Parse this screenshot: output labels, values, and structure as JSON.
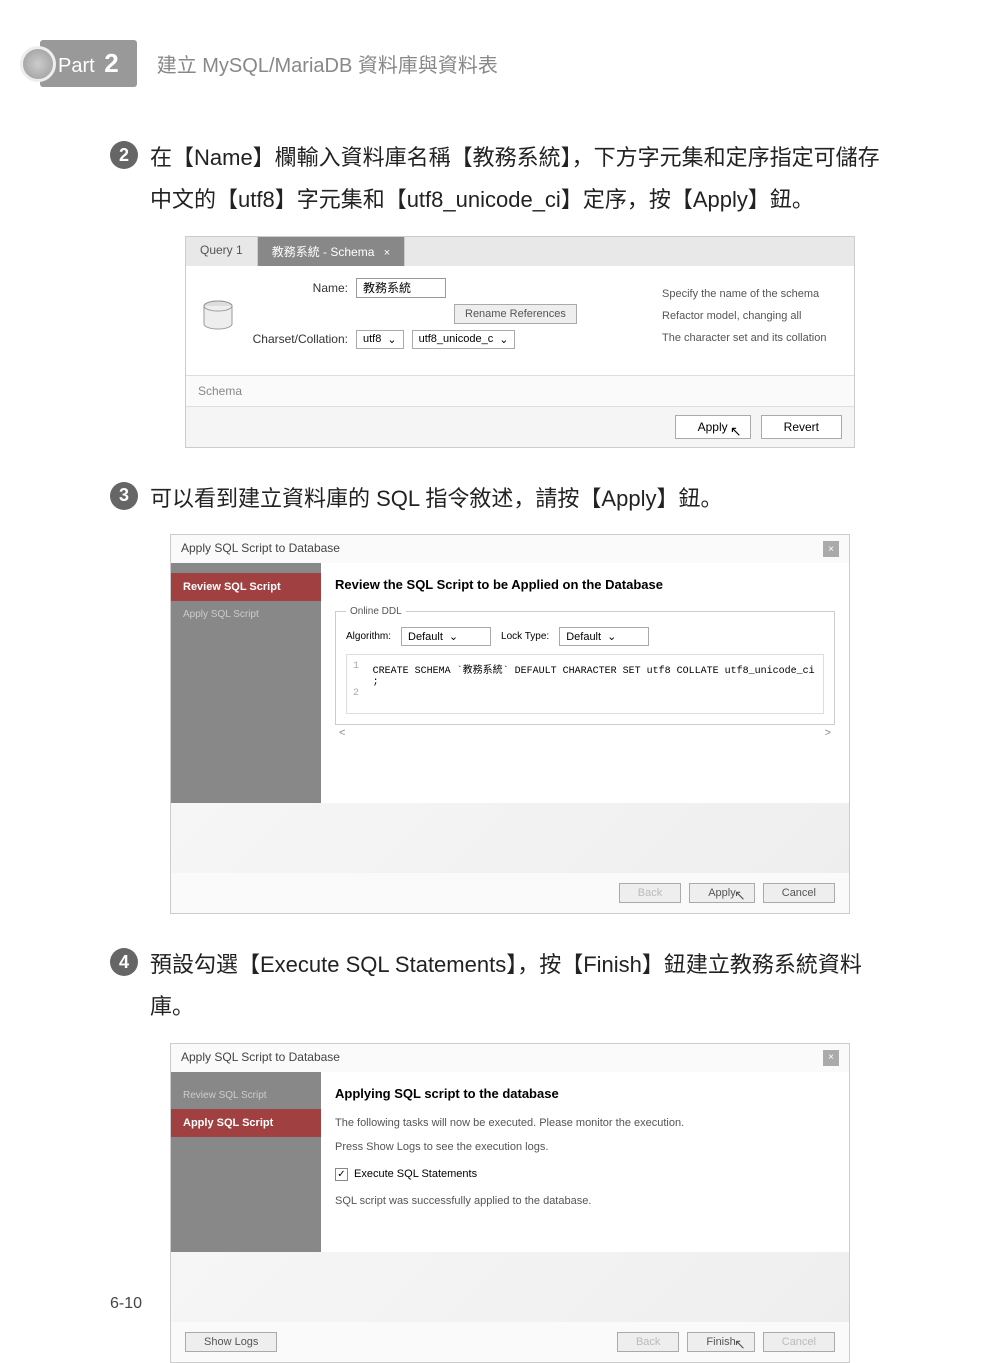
{
  "header": {
    "part_label": "Part",
    "part_num": "2",
    "title": "建立 MySQL/MariaDB 資料庫與資料表"
  },
  "step2": {
    "badge": "2",
    "text": "在【Name】欄輸入資料庫名稱【教務系統】，下方字元集和定序指定可儲存中文的【utf8】字元集和【utf8_unicode_ci】定序，按【Apply】鈕。"
  },
  "ss1": {
    "tab1": "Query 1",
    "tab2": "教務系統 - Schema",
    "name_label": "Name:",
    "name_value": "教務系統",
    "rename_btn": "Rename References",
    "charset_label": "Charset/Collation:",
    "charset_value": "utf8",
    "collation_value": "utf8_unicode_c",
    "desc1": "Specify the name of the schema",
    "desc2": "Refactor model, changing all",
    "desc3": "The character set and its collation",
    "schema_label": "Schema",
    "apply_btn": "Apply",
    "revert_btn": "Revert"
  },
  "step3": {
    "badge": "3",
    "text": "可以看到建立資料庫的 SQL 指令敘述，請按【Apply】鈕。"
  },
  "ss2": {
    "dialog_title": "Apply SQL Script to Database",
    "side1": "Review SQL Script",
    "side2": "Apply SQL Script",
    "panel_title": "Review the SQL Script to be Applied on the Database",
    "legend": "Online DDL",
    "algo_label": "Algorithm:",
    "algo_value": "Default",
    "lock_label": "Lock Type:",
    "lock_value": "Default",
    "sql_code": "CREATE SCHEMA `教務系統` DEFAULT CHARACTER SET utf8 COLLATE utf8_unicode_ci ;",
    "back_btn": "Back",
    "apply_btn": "Apply",
    "cancel_btn": "Cancel"
  },
  "step4": {
    "badge": "4",
    "text": "預設勾選【Execute SQL Statements】，按【Finish】鈕建立教務系統資料庫。"
  },
  "ss3": {
    "dialog_title": "Apply SQL Script to Database",
    "side1": "Review SQL Script",
    "side2": "Apply SQL Script",
    "panel_title": "Applying SQL script to the database",
    "info1": "The following tasks will now be executed. Please monitor the execution.",
    "info2": "Press Show Logs to see the execution logs.",
    "checkbox_label": "Execute SQL Statements",
    "success_msg": "SQL script was successfully applied to the database.",
    "showlogs_btn": "Show Logs",
    "back_btn": "Back",
    "finish_btn": "Finish",
    "cancel_btn": "Cancel"
  },
  "page_num": "6-10"
}
